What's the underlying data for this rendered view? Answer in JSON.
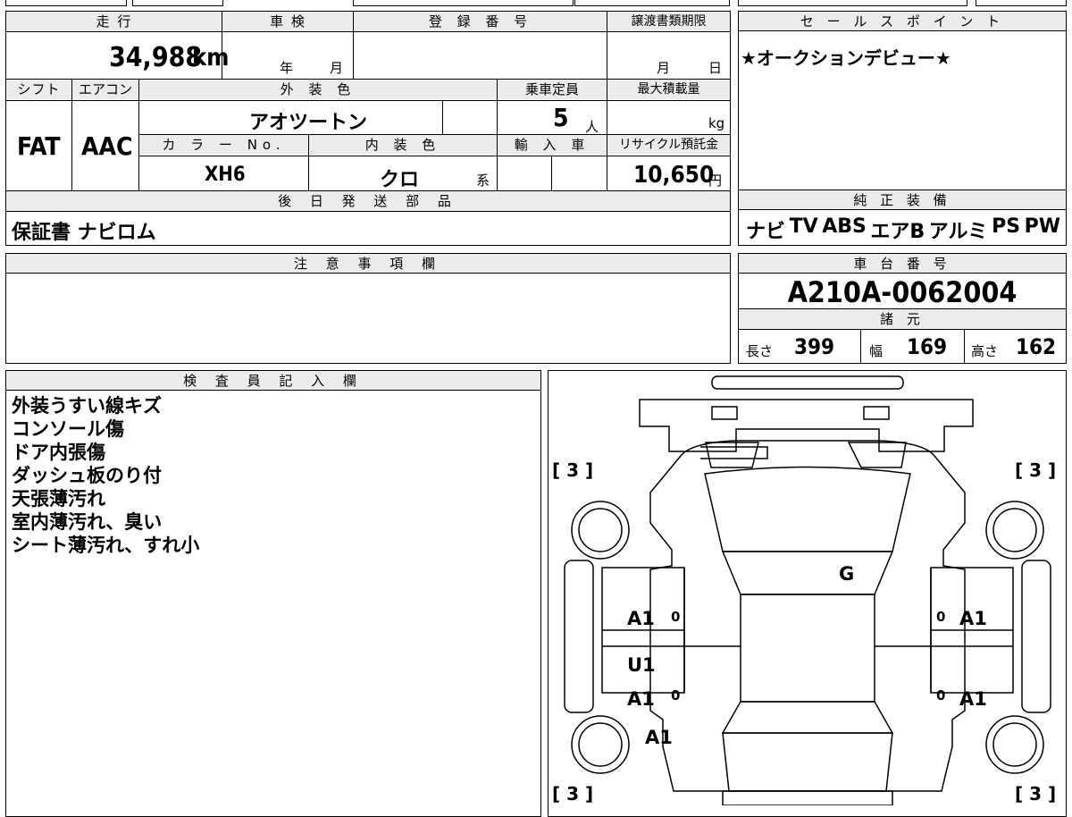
{
  "main": {
    "mileage_label": "走 行",
    "mileage_value": "34,988",
    "mileage_unit": "km",
    "shaken_label": "車 検",
    "shaken_year": "年",
    "shaken_month": "月",
    "reg_label": "登 録 番 号",
    "transfer_label": "譲渡書類期限",
    "transfer_month": "月",
    "transfer_day": "日",
    "shift_label": "シフト",
    "shift_value": "FAT",
    "ac_label": "エアコン",
    "ac_value": "AAC",
    "ext_color_label": "外 装 色",
    "ext_color_value": "アオツートン",
    "capacity_label": "乗車定員",
    "capacity_value": "5",
    "capacity_unit": "人",
    "max_load_label": "最大積載量",
    "max_load_unit": "kg",
    "color_no_label": "カ ラ ー No.",
    "color_no_value": "XH6",
    "int_color_label": "内 装 色",
    "int_color_value": "クロ",
    "int_color_suffix": "系",
    "import_label": "輸 入 車",
    "recycle_label": "リサイクル預託金",
    "recycle_value": "10,650",
    "recycle_unit": "円",
    "later_parts_label": "後 日 発 送 部 品",
    "later_parts_value": "保証書 ナビロム"
  },
  "sales_point": {
    "label": "セ ー ル ス ポ イ ン ト",
    "text": "★オークションデビュー★"
  },
  "equipment": {
    "label": "純 正 装 備",
    "items": [
      "ナビ",
      "TV",
      "ABS",
      "エアB",
      "アルミ",
      "PS",
      "PW"
    ]
  },
  "notes": {
    "label": "注 意 事 項 欄"
  },
  "chassis": {
    "label": "車 台 番 号",
    "value": "A210A-0062004",
    "specs_label": "諸 元",
    "length_label": "長さ",
    "length_value": "399",
    "width_label": "幅",
    "width_value": "169",
    "height_label": "高さ",
    "height_value": "162"
  },
  "inspector": {
    "label": "検 査 員 記 入 欄",
    "lines": [
      "外装うすい線キズ",
      "コンソール傷",
      "ドア内張傷",
      "ダッシュ板のり付",
      "天張薄汚れ",
      "室内薄汚れ、臭い",
      "シート薄汚れ、すれ小"
    ]
  },
  "diagram": {
    "tire_marks": [
      "[ 3 ]",
      "[ 3 ]",
      "[ 3 ]",
      "[ 3 ]"
    ],
    "windshield_mark": "G",
    "left_front_door": "A1",
    "left_rear_door_1": "U1",
    "left_rear_door_2": "A1",
    "left_rear_fender": "A1",
    "right_front_door": "A1",
    "right_rear_door": "A1",
    "zero_marks": [
      "0",
      "0",
      "0",
      "0"
    ]
  }
}
